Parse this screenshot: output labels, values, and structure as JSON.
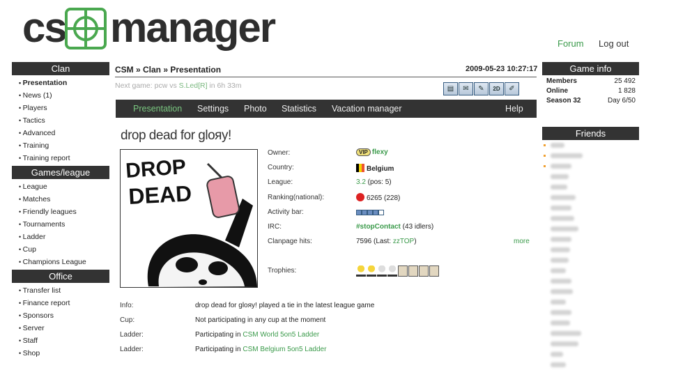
{
  "logo": {
    "part1": "cs",
    "part2": "manager"
  },
  "topnav": {
    "forum": "Forum",
    "logout": "Log out"
  },
  "sidebar": {
    "sections": [
      {
        "title": "Clan",
        "items": [
          "Presentation",
          "News (1)",
          "Players",
          "Tactics",
          "Advanced",
          "Training",
          "Training report"
        ]
      },
      {
        "title": "Games/league",
        "items": [
          "League",
          "Matches",
          "Friendly leagues",
          "Tournaments",
          "Ladder",
          "Cup",
          "Champions League"
        ]
      },
      {
        "title": "Office",
        "items": [
          "Transfer list",
          "Finance report",
          "Sponsors",
          "Server",
          "Staff",
          "Shop"
        ]
      }
    ]
  },
  "header": {
    "breadcrumb": "CSM » Clan » Presentation",
    "datetime": "2009-05-23 10:27:17",
    "next_game_prefix": "Next game: pcw vs ",
    "next_game_opponent": "S.Led[R]",
    "next_game_suffix": " in 6h 33m",
    "toolbar_icons": [
      "book-icon",
      "mail-icon",
      "notes-icon",
      "2d-icon",
      "edit-icon"
    ]
  },
  "tabs": [
    "Presentation",
    "Settings",
    "Photo",
    "Statistics",
    "Vacation manager",
    "Help"
  ],
  "clan": {
    "title": "drop dead for gloяy!",
    "logo_text": "DROP DEAD",
    "owner_label": "Owner:",
    "owner_vip": "VIP",
    "owner_name": "flexy",
    "country_label": "Country:",
    "country": "Belgium",
    "league_label": "League:",
    "league": "3.2",
    "league_pos": " (pos: 5)",
    "ranking_label": "Ranking(national):",
    "ranking": "6265 (228)",
    "activity_label": "Activity bar:",
    "activity_level": 0.8,
    "irc_label": "IRC:",
    "irc_channel": "#stopContact",
    "irc_idlers": " (43 idlers)",
    "hits_label": "Clanpage hits:",
    "hits": "7596 (Last: ",
    "hits_last": "zzTOP",
    "hits_close": ")",
    "more": "more",
    "trophies_label": "Trophies:"
  },
  "details": [
    {
      "label": "Info:",
      "value": "drop dead for gloяy! played a tie in the latest league game",
      "link": ""
    },
    {
      "label": "Cup:",
      "value": "Not participating in any cup at the moment",
      "link": ""
    },
    {
      "label": "Ladder:",
      "value": "Participating in ",
      "link": "CSM World 5on5 Ladder"
    },
    {
      "label": "Ladder:",
      "value": "Participating in ",
      "link": "CSM Belgium 5on5 Ladder"
    }
  ],
  "game_info": {
    "title": "Game info",
    "rows": [
      {
        "label": "Members",
        "value": "25 492"
      },
      {
        "label": "Online",
        "value": "1 828"
      },
      {
        "label": "Season 32",
        "value": "Day 6/50"
      }
    ]
  },
  "friends": {
    "title": "Friends",
    "count": 22
  },
  "colors": {
    "accent": "#3a9a4a",
    "bar": "#333333"
  }
}
